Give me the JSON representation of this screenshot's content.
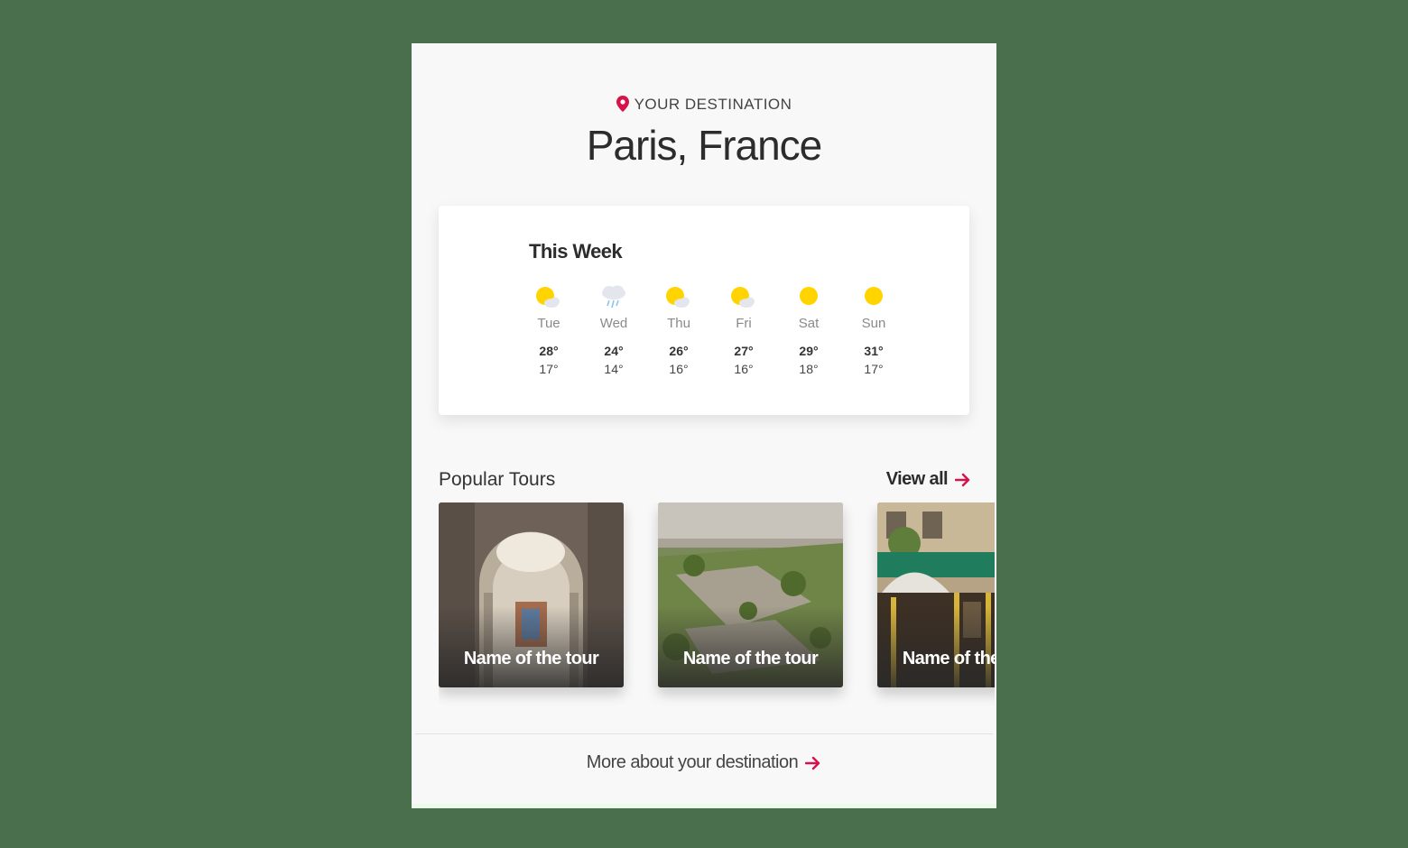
{
  "header": {
    "label": "YOUR DESTINATION",
    "city": "Paris, France",
    "accent": "#d6124a"
  },
  "weather": {
    "title": "This Week",
    "days": [
      {
        "day": "Tue",
        "hi": "28°",
        "lo": "17°",
        "icon": "partly-sunny-icon"
      },
      {
        "day": "Wed",
        "hi": "24°",
        "lo": "14°",
        "icon": "rain-icon"
      },
      {
        "day": "Thu",
        "hi": "26°",
        "lo": "16°",
        "icon": "partly-sunny-icon"
      },
      {
        "day": "Fri",
        "hi": "27°",
        "lo": "16°",
        "icon": "partly-sunny-icon"
      },
      {
        "day": "Sat",
        "hi": "29°",
        "lo": "18°",
        "icon": "sun-icon"
      },
      {
        "day": "Sun",
        "hi": "31°",
        "lo": "17°",
        "icon": "sun-icon"
      }
    ]
  },
  "tours": {
    "title": "Popular Tours",
    "view_all": "View all",
    "items": [
      {
        "name": "Name of the tour"
      },
      {
        "name": "Name of the tour"
      },
      {
        "name": "Name of the tour"
      }
    ]
  },
  "footer": {
    "more": "More about your destination"
  }
}
